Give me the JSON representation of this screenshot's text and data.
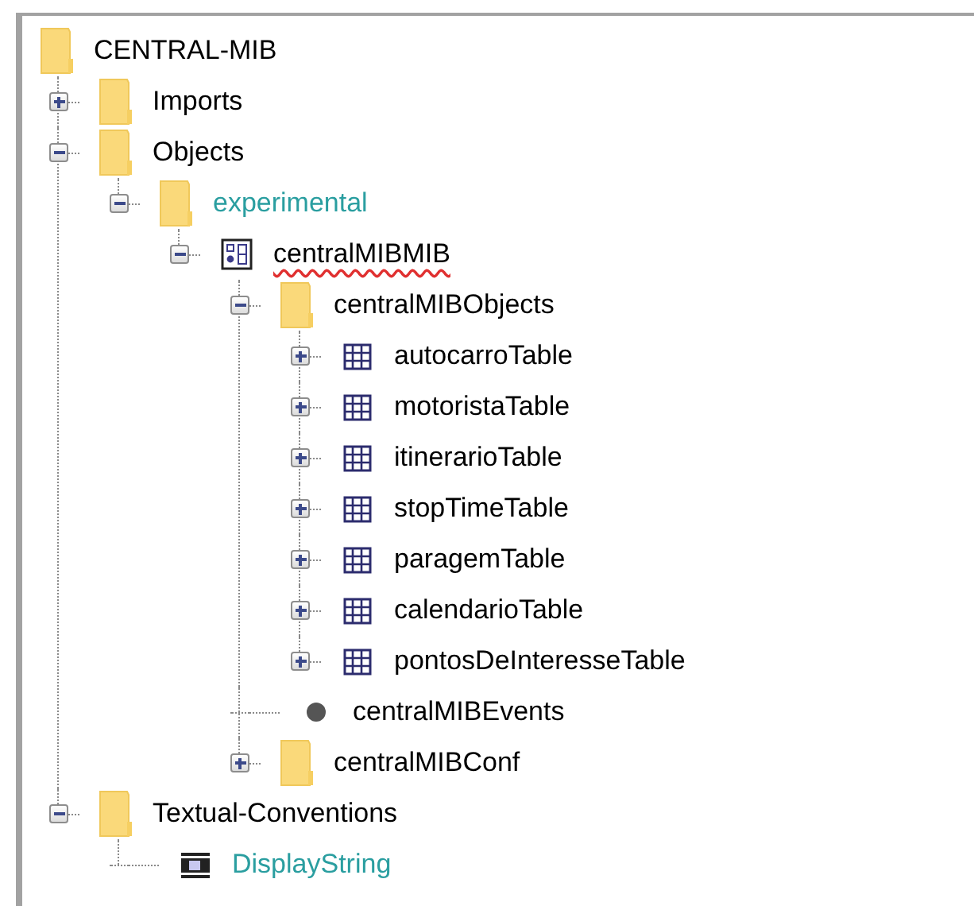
{
  "tree": [
    {
      "label": "CENTRAL-MIB",
      "kind": "folder",
      "misspelled": false,
      "color": "#000000",
      "children": [
        {
          "label": "Imports",
          "kind": "folder",
          "expanded": false,
          "misspelled": false,
          "color": "#000000"
        },
        {
          "label": "Objects",
          "kind": "folder",
          "expanded": true,
          "misspelled": false,
          "color": "#000000",
          "children": [
            {
              "label": "experimental",
              "kind": "folder",
              "expanded": true,
              "misspelled": false,
              "color": "#2a9ea0",
              "children": [
                {
                  "label": "centralMIBMIB",
                  "kind": "module",
                  "expanded": true,
                  "misspelled": true,
                  "color": "#000000",
                  "children": [
                    {
                      "label": "centralMIBObjects",
                      "kind": "folder",
                      "expanded": true,
                      "misspelled": false,
                      "color": "#000000",
                      "children": [
                        {
                          "label": "autocarroTable",
                          "kind": "table",
                          "expanded": false,
                          "misspelled": false,
                          "color": "#000000"
                        },
                        {
                          "label": "motoristaTable",
                          "kind": "table",
                          "expanded": false,
                          "misspelled": false,
                          "color": "#000000"
                        },
                        {
                          "label": "itinerarioTable",
                          "kind": "table",
                          "expanded": false,
                          "misspelled": false,
                          "color": "#000000"
                        },
                        {
                          "label": "stopTimeTable",
                          "kind": "table",
                          "expanded": false,
                          "misspelled": false,
                          "color": "#000000"
                        },
                        {
                          "label": "paragemTable",
                          "kind": "table",
                          "expanded": false,
                          "misspelled": false,
                          "color": "#000000"
                        },
                        {
                          "label": "calendarioTable",
                          "kind": "table",
                          "expanded": false,
                          "misspelled": false,
                          "color": "#000000"
                        },
                        {
                          "label": "pontosDeInteresseTable",
                          "kind": "table",
                          "expanded": false,
                          "misspelled": false,
                          "color": "#000000"
                        }
                      ]
                    },
                    {
                      "label": "centralMIBEvents",
                      "kind": "event",
                      "misspelled": false,
                      "color": "#000000"
                    },
                    {
                      "label": "centralMIBConf",
                      "kind": "folder",
                      "expanded": false,
                      "misspelled": false,
                      "color": "#000000"
                    }
                  ]
                }
              ]
            }
          ]
        },
        {
          "label": "Textual-Conventions",
          "kind": "folder",
          "expanded": true,
          "misspelled": false,
          "color": "#000000",
          "children": [
            {
              "label": "DisplayString",
              "kind": "textual-convention",
              "misspelled": false,
              "color": "#2a9ea0"
            }
          ]
        }
      ]
    }
  ]
}
